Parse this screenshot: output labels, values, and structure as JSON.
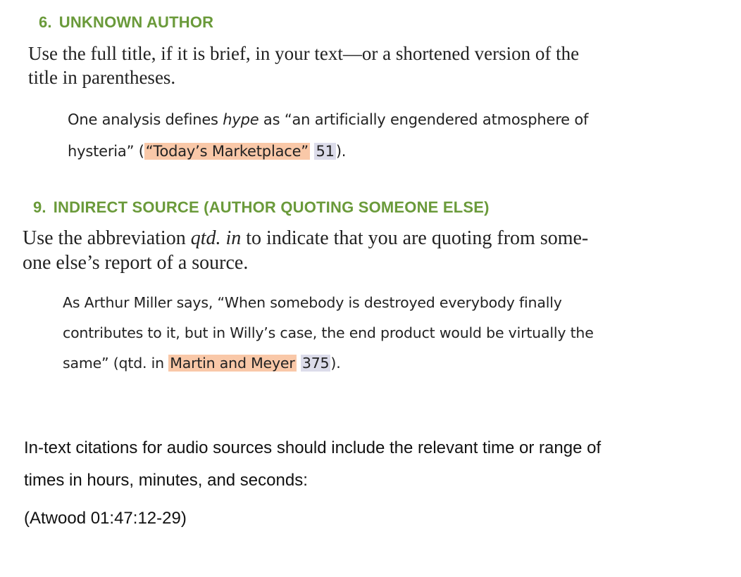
{
  "section6": {
    "number": "6.",
    "title": "UNKNOWN AUTHOR",
    "rule_line1": "Use the full title, if it is brief, in your text—or a shortened version of the",
    "rule_line2": "title in parentheses.",
    "example": {
      "part1": "One analysis defines ",
      "italic_word": "hype",
      "part2": " as “an artificially engendered atmosphere of",
      "part3": "hysteria” (",
      "source": "“Today’s Marketplace”",
      "space": " ",
      "page": "51",
      "end": ")."
    }
  },
  "section9": {
    "number": "9.",
    "title": "INDIRECT SOURCE (AUTHOR QUOTING SOMEONE ELSE)",
    "rule_part1": "Use the abbreviation ",
    "rule_italic": "qtd. in",
    "rule_part2": " to indicate that you are quoting from some-",
    "rule_line2": "one else’s report of a source.",
    "example": {
      "line1": "As Arthur Miller says, “When somebody is destroyed everybody finally",
      "line2": "contributes to it, but in Willy’s case, the end product would be virtually the",
      "part3": "same” (qtd. in ",
      "source": "Martin and Meyer",
      "space": " ",
      "page": "375",
      "end": ")."
    }
  },
  "audio": {
    "line1": "In-text citations for audio sources should include the relevant time or range of",
    "line2": "times in hours, minutes, and seconds:",
    "example": "(Atwood 01:47:12-29)"
  },
  "colors": {
    "heading": "#6a9a3a",
    "source_highlight": "#f9c8a8",
    "page_highlight": "#dcdcea"
  }
}
